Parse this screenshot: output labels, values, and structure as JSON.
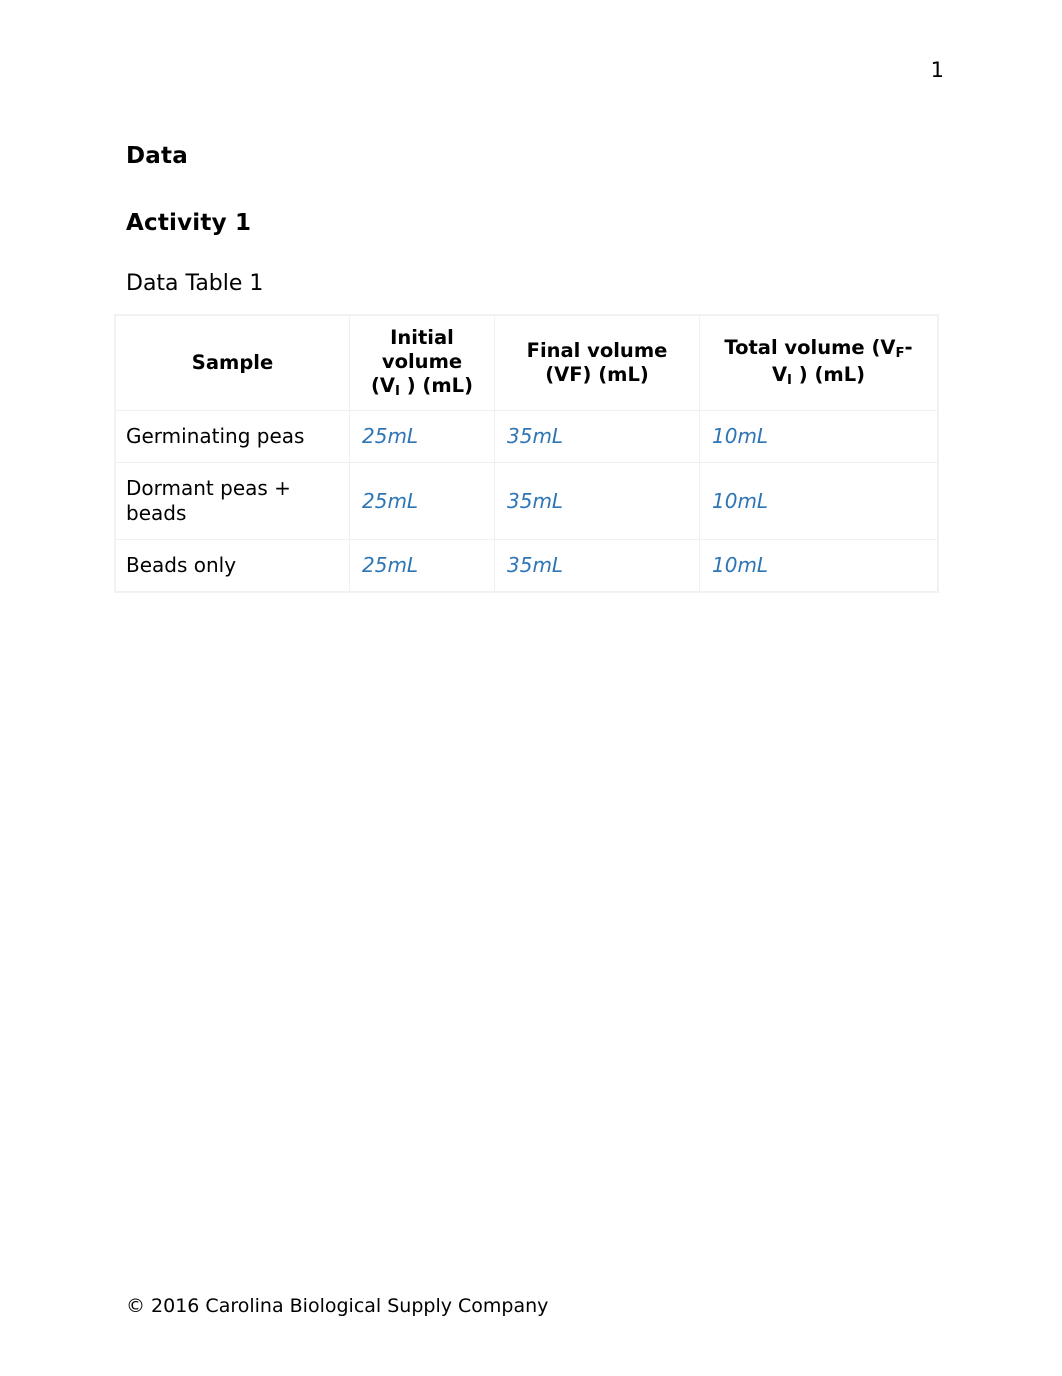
{
  "document": {
    "page_number": "1",
    "footer": "© 2016 Carolina Biological Supply Company",
    "headings": {
      "data": "Data",
      "activity": "Activity 1",
      "table_caption": "Data Table 1"
    }
  },
  "table": {
    "name": "Data Table 1",
    "headers": {
      "sample": "Sample",
      "initial_volume_line1": "Initial",
      "initial_volume_line2": "volume",
      "initial_volume_line3_pre": "(V",
      "initial_volume_sub": "I",
      "initial_volume_line3_post": " ) (mL)",
      "final_volume_line1": "Final volume",
      "final_volume_line2": "(VF) (mL)",
      "total_volume_line1_pre": "Total volume (V",
      "total_volume_sub1": "F",
      "total_volume_line1_post": "-",
      "total_volume_line2_pre": "V",
      "total_volume_sub2": "I",
      "total_volume_line2_post": " ) (mL)"
    },
    "rows": [
      {
        "sample": "Germinating peas",
        "initial_volume": "25mL",
        "final_volume": "35mL",
        "total_volume": "10mL"
      },
      {
        "sample": "Dormant peas + beads",
        "initial_volume": "25mL",
        "final_volume": "35mL",
        "total_volume": "10mL"
      },
      {
        "sample": "Beads only",
        "initial_volume": "25mL",
        "final_volume": "35mL",
        "total_volume": "10mL"
      }
    ]
  },
  "colors": {
    "value_text": "#2e75b6",
    "body_text": "#000000",
    "table_border": "#f0f0f0"
  }
}
